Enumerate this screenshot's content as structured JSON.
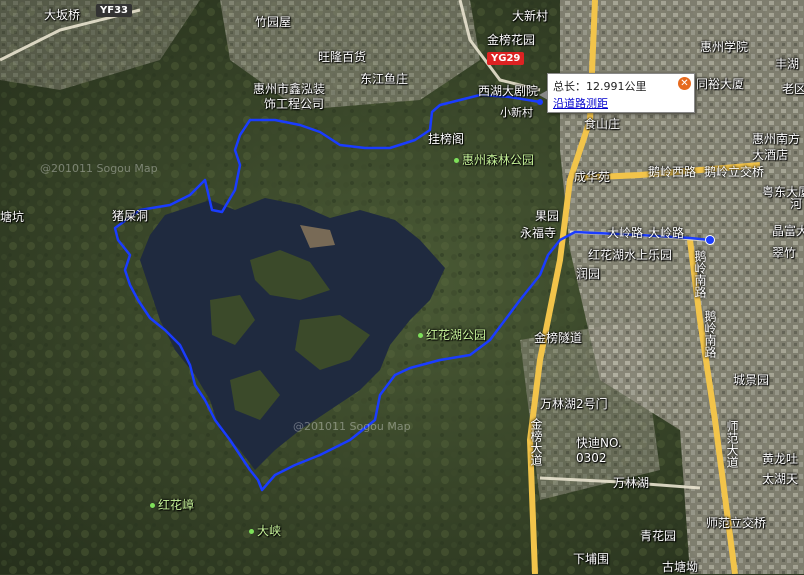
{
  "popup": {
    "total_label": "总长：",
    "total_value": "12.991公里",
    "measure_link": "沿道路测距",
    "close_icon": "close-icon"
  },
  "watermarks": [
    "@201011 Sogou Map",
    "@201011 Sogou Map"
  ],
  "shields": [
    "YF33",
    "YG29"
  ],
  "places": [
    {
      "id": "dabanqiao",
      "text": "大坂桥"
    },
    {
      "id": "zhuyuanwu",
      "text": "竹园屋"
    },
    {
      "id": "jinbangyuan",
      "text": "金榜花园"
    },
    {
      "id": "dunxincun",
      "text": "大新村"
    },
    {
      "id": "huizhouxueyuan",
      "text": "惠州学院"
    },
    {
      "id": "wanglongbaihuo",
      "text": "旺隆百货"
    },
    {
      "id": "dongjianyuzhuang",
      "text": "东江鱼庄"
    },
    {
      "id": "xinhongzhuang",
      "text": "惠州市鑫泓装"
    },
    {
      "id": "xinhongzhuang2",
      "text": "饰工程公司"
    },
    {
      "id": "xihudajuyuan",
      "text": "西湖大剧院"
    },
    {
      "id": "xiaoxincun",
      "text": "小新村"
    },
    {
      "id": "shishanzhuang",
      "text": "食山庄"
    },
    {
      "id": "tongyudasha",
      "text": "同裕大厦"
    },
    {
      "id": "huizhounanfang",
      "text": "惠州南方"
    },
    {
      "id": "daxijiudian",
      "text": "大酒店"
    },
    {
      "id": "guabangge",
      "text": "挂榜阁"
    },
    {
      "id": "senlingongyuan",
      "text": "惠州森林公园"
    },
    {
      "id": "chenghuayuan",
      "text": "成华苑"
    },
    {
      "id": "elingxilu",
      "text": "鹅岭西路"
    },
    {
      "id": "elinglijiaoqiao",
      "text": "鹅岭立交桥"
    },
    {
      "id": "yuedadasha",
      "text": "粤东大厦"
    },
    {
      "id": "jingfuqi",
      "text": "晶富大"
    },
    {
      "id": "cuiqi",
      "text": "翠竹"
    },
    {
      "id": "tangkeng",
      "text": "塘坑"
    },
    {
      "id": "zhushikeng",
      "text": "猪屎洞"
    },
    {
      "id": "guoyuan",
      "text": "果园"
    },
    {
      "id": "yongfusi",
      "text": "永福寺"
    },
    {
      "id": "dalinglu",
      "text": "大岭路"
    },
    {
      "id": "dalinglu2",
      "text": "大岭路"
    },
    {
      "id": "honghuahushuishang",
      "text": "红花湖水上乐园"
    },
    {
      "id": "runyuan",
      "text": "润园"
    },
    {
      "id": "elingnanlu",
      "text": "鹅岭南路"
    },
    {
      "id": "elingnanlu2",
      "text": "鹅岭南路"
    },
    {
      "id": "honghuahugongyuan",
      "text": "红花湖公园"
    },
    {
      "id": "jinbangsuidao",
      "text": "金榜隧道"
    },
    {
      "id": "chengjingyuan",
      "text": "城景园"
    },
    {
      "id": "wanlinhu2haomen",
      "text": "万林湖2号门"
    },
    {
      "id": "jinbangdadao",
      "text": "金榜大道"
    },
    {
      "id": "shifandadao",
      "text": "师范大道"
    },
    {
      "id": "kuaidi",
      "text": "快迪NO."
    },
    {
      "id": "kuaidi2",
      "text": "0302"
    },
    {
      "id": "wanlinhu",
      "text": "万林湖"
    },
    {
      "id": "huanglongtu",
      "text": "黄龙吐"
    },
    {
      "id": "taiqizhen",
      "text": "太湖天"
    },
    {
      "id": "honghuazhang",
      "text": "红花嶂"
    },
    {
      "id": "daxia",
      "text": "大峡"
    },
    {
      "id": "shifanlijiaoqiao",
      "text": "师范立交桥"
    },
    {
      "id": "qinghuayuan",
      "text": "青花园"
    },
    {
      "id": "xiapuwei",
      "text": "下埔围"
    },
    {
      "id": "gutangao",
      "text": "古塘坳"
    },
    {
      "id": "fengwei",
      "text": "丰湖"
    },
    {
      "id": "laoyi",
      "text": "老区"
    },
    {
      "id": "hequ",
      "text": "河"
    }
  ],
  "colors": {
    "route": "#1a3cff",
    "water": "#1f2a3f",
    "close": "#e66a1e",
    "link": "#0000cc"
  }
}
